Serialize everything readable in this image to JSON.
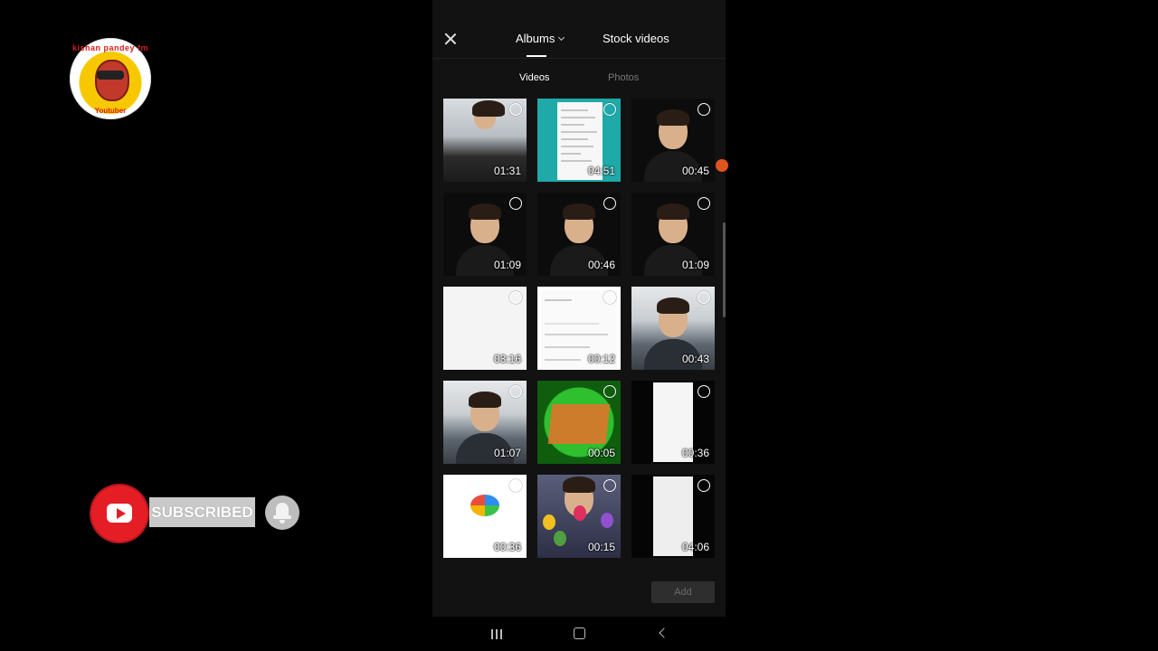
{
  "channel": {
    "logo_top_text": "kishan pandey fm",
    "logo_bottom_text": "Youtuber"
  },
  "subscribe": {
    "label": "SUBSCRIBED"
  },
  "picker": {
    "tabs": [
      {
        "label": "Albums",
        "active": true
      },
      {
        "label": "Stock videos",
        "active": false
      }
    ],
    "sub_tabs": [
      {
        "label": "Videos",
        "active": true
      },
      {
        "label": "Photos",
        "active": false
      }
    ],
    "videos": [
      {
        "duration": "01:31",
        "thumb": "room"
      },
      {
        "duration": "04:51",
        "thumb": "teal-settings"
      },
      {
        "duration": "00:45",
        "thumb": "person-dark"
      },
      {
        "duration": "01:09",
        "thumb": "person-dark"
      },
      {
        "duration": "00:46",
        "thumb": "person-dark"
      },
      {
        "duration": "01:09",
        "thumb": "person-dark"
      },
      {
        "duration": "03:16",
        "thumb": "white"
      },
      {
        "duration": "00:12",
        "thumb": "help-support"
      },
      {
        "duration": "00:43",
        "thumb": "person-room"
      },
      {
        "duration": "01:07",
        "thumb": "person-room"
      },
      {
        "duration": "00:05",
        "thumb": "green-logo"
      },
      {
        "duration": "00:36",
        "thumb": "phone-doc"
      },
      {
        "duration": "00:36",
        "thumb": "doc"
      },
      {
        "duration": "00:15",
        "thumb": "party"
      },
      {
        "duration": "04:06",
        "thumb": "phone-doc"
      }
    ],
    "add_label": "Add"
  },
  "colors": {
    "background": "#000000",
    "screen": "#121212",
    "youtube_red": "#e51e25",
    "accent_teal": "#1fa9a9"
  },
  "icons": {
    "close": "close-icon",
    "dropdown": "chevron-down-icon",
    "select": "radio-circle-icon",
    "nav_recent": "recent-apps-icon",
    "nav_home": "home-icon",
    "nav_back": "back-icon",
    "bell": "bell-icon",
    "youtube": "youtube-play-icon"
  }
}
